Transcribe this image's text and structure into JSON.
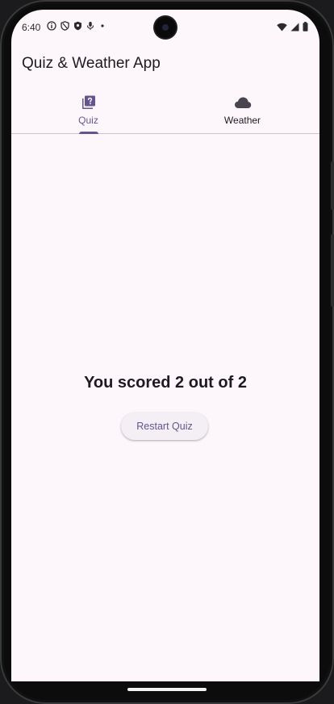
{
  "status_bar": {
    "time": "6:40",
    "icons": [
      "info-icon",
      "shield-icon",
      "shield-filled-icon",
      "mic-icon",
      "dot-icon"
    ],
    "right_icons": [
      "wifi-icon",
      "signal-icon",
      "battery-icon"
    ]
  },
  "app_bar": {
    "title": "Quiz & Weather App"
  },
  "tabs": [
    {
      "label": "Quiz",
      "icon": "quiz-icon",
      "active": true
    },
    {
      "label": "Weather",
      "icon": "cloud-icon",
      "active": false
    }
  ],
  "result": {
    "score_text": "You scored 2 out of 2",
    "restart_label": "Restart Quiz"
  },
  "colors": {
    "primary": "#65558f",
    "background": "#fdf7fc",
    "on_surface": "#1d1b20"
  }
}
